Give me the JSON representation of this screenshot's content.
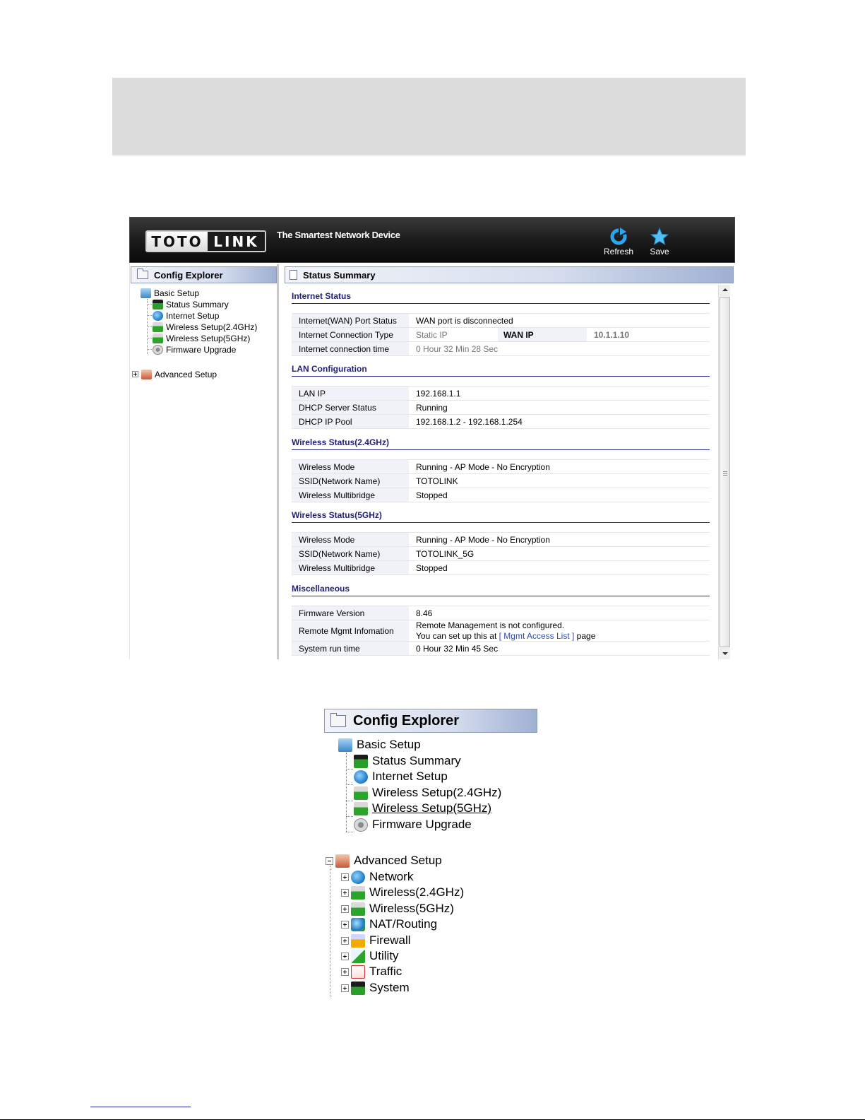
{
  "header": {
    "logo_left": "TOTO",
    "logo_right": "LINK",
    "tagline": "The Smartest Network Device",
    "refresh_label": "Refresh",
    "save_label": "Save"
  },
  "explorer": {
    "title": "Config Explorer",
    "basic_setup": "Basic Setup",
    "basic_items": [
      "Status Summary",
      "Internet Setup",
      "Wireless Setup(2.4GHz)",
      "Wireless Setup(5GHz)",
      "Firmware Upgrade"
    ],
    "advanced_setup": "Advanced Setup",
    "advanced_items": [
      "Network",
      "Wireless(2.4GHz)",
      "Wireless(5GHz)",
      "NAT/Routing",
      "Firewall",
      "Utility",
      "Traffic",
      "System"
    ]
  },
  "status": {
    "title": "Status Summary",
    "internet": {
      "heading": "Internet Status",
      "port_status_label": "Internet(WAN) Port Status",
      "port_status_value": "WAN port is disconnected",
      "conn_type_label": "Internet Connection Type",
      "conn_type_value": "Static IP",
      "wan_ip_label": "WAN IP",
      "wan_ip_value": "10.1.1.10",
      "conn_time_label": "Internet connection time",
      "conn_time_value": "0 Hour 32 Min 28 Sec"
    },
    "lan": {
      "heading": "LAN Configuration",
      "rows": [
        {
          "label": "LAN IP",
          "value": "192.168.1.1"
        },
        {
          "label": "DHCP Server Status",
          "value": "Running"
        },
        {
          "label": "DHCP IP Pool",
          "value": "192.168.1.2 -  192.168.1.254"
        }
      ]
    },
    "wireless24": {
      "heading": "Wireless Status(2.4GHz)",
      "rows": [
        {
          "label": "Wireless Mode",
          "value": "Running - AP Mode - No Encryption"
        },
        {
          "label": "SSID(Network Name)",
          "value": "TOTOLINK"
        },
        {
          "label": "Wireless Multibridge",
          "value": "Stopped"
        }
      ]
    },
    "wireless5": {
      "heading": "Wireless Status(5GHz)",
      "rows": [
        {
          "label": "Wireless Mode",
          "value": "Running - AP Mode - No Encryption"
        },
        {
          "label": "SSID(Network Name)",
          "value": "TOTOLINK_5G"
        },
        {
          "label": "Wireless Multibridge",
          "value": "Stopped"
        }
      ]
    },
    "misc": {
      "heading": "Miscellaneous",
      "fw_label": "Firmware Version",
      "fw_value": "8.46",
      "remote_label": "Remote Mgmt Infomation",
      "remote_line1": "Remote Management is not configured.",
      "remote_line2_prefix": "You can set up this at ",
      "remote_link": "[ Mgmt Access List ]",
      "remote_line2_suffix": " page",
      "runtime_label": "System run time",
      "runtime_value": "0 Hour 32 Min 45 Sec"
    }
  }
}
